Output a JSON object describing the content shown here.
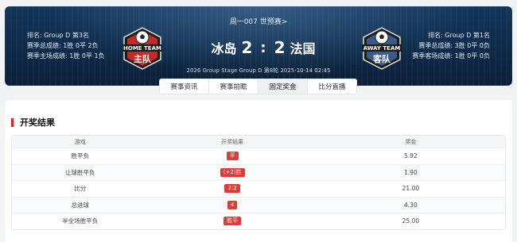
{
  "hero": {
    "title": "周一007 世预赛>",
    "home": {
      "stats": [
        "排名: Group D 第3名",
        "赛季总成绩: 1胜 0平 2负",
        "赛季主场成绩: 1胜 0平 1负"
      ],
      "badge_top": "HOME TEAM",
      "badge_main": "主队",
      "name": "冰岛",
      "score": "2"
    },
    "away": {
      "stats": [
        "排名: Group D 第1名",
        "赛季总成绩: 3胜 0平 0负",
        "赛季客场成绩: 1胜 0平 0负"
      ],
      "badge_top": "AWAY TEAM",
      "badge_main": "客队",
      "name": "法国",
      "score": "2"
    },
    "separator": ":",
    "match_info": "2026 Group Stage Group D 第8轮 2025-10-14 02:45"
  },
  "tabs": [
    {
      "label": "赛事资讯"
    },
    {
      "label": "赛事前瞻"
    },
    {
      "label": "固定奖金",
      "active": true
    },
    {
      "label": "比分直播"
    }
  ],
  "results": {
    "title": "开奖结果",
    "headers": [
      "游戏",
      "开奖结果",
      "奖金"
    ],
    "rows": [
      {
        "game": "胜平负",
        "result": "平",
        "prize": "5.92"
      },
      {
        "game": "让球胜平负",
        "result": "(+2)胜",
        "prize": "1.90"
      },
      {
        "game": "比分",
        "result": "2:2",
        "prize": "21.00"
      },
      {
        "game": "总进球",
        "result": "4",
        "prize": "4.30"
      },
      {
        "game": "半全场胜平负",
        "result": "胜平",
        "prize": "25.00"
      }
    ]
  },
  "colors": {
    "accent_red": "#e02020",
    "hero_bg": "#0d2a48",
    "badge_home": "#c62828",
    "badge_away": "#3a5a8c"
  }
}
